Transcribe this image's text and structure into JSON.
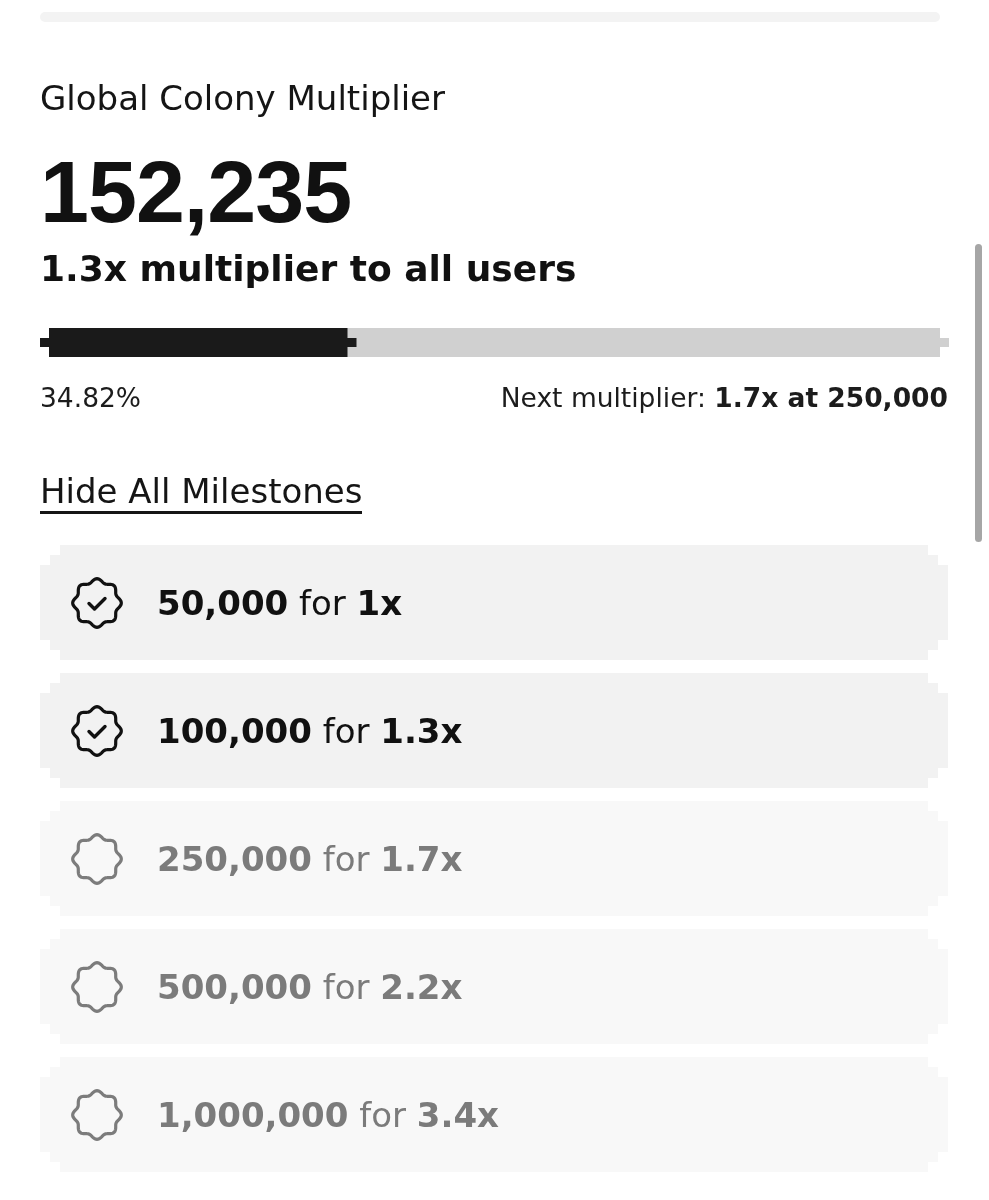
{
  "header": {
    "title": "Global Colony Multiplier",
    "count": "152,235",
    "subtitle": "1.3x multiplier to all users"
  },
  "progress": {
    "level": 0.3482,
    "percent": "34.82%",
    "next": "Next multiplier: **1.7x at 250,000**"
  },
  "toggle_link": "Hide All Milestones",
  "milestones": [
    {
      "label": "**50,000** for **1x**",
      "achieved": true
    },
    {
      "label": "**100,000** for **1.3x**",
      "achieved": true
    },
    {
      "label": "**250,000** for **1.7x**",
      "achieved": false
    },
    {
      "label": "**500,000** for **2.2x**",
      "achieved": false
    },
    {
      "label": "**1,000,000** for **3.4x**",
      "achieved": false
    }
  ]
}
